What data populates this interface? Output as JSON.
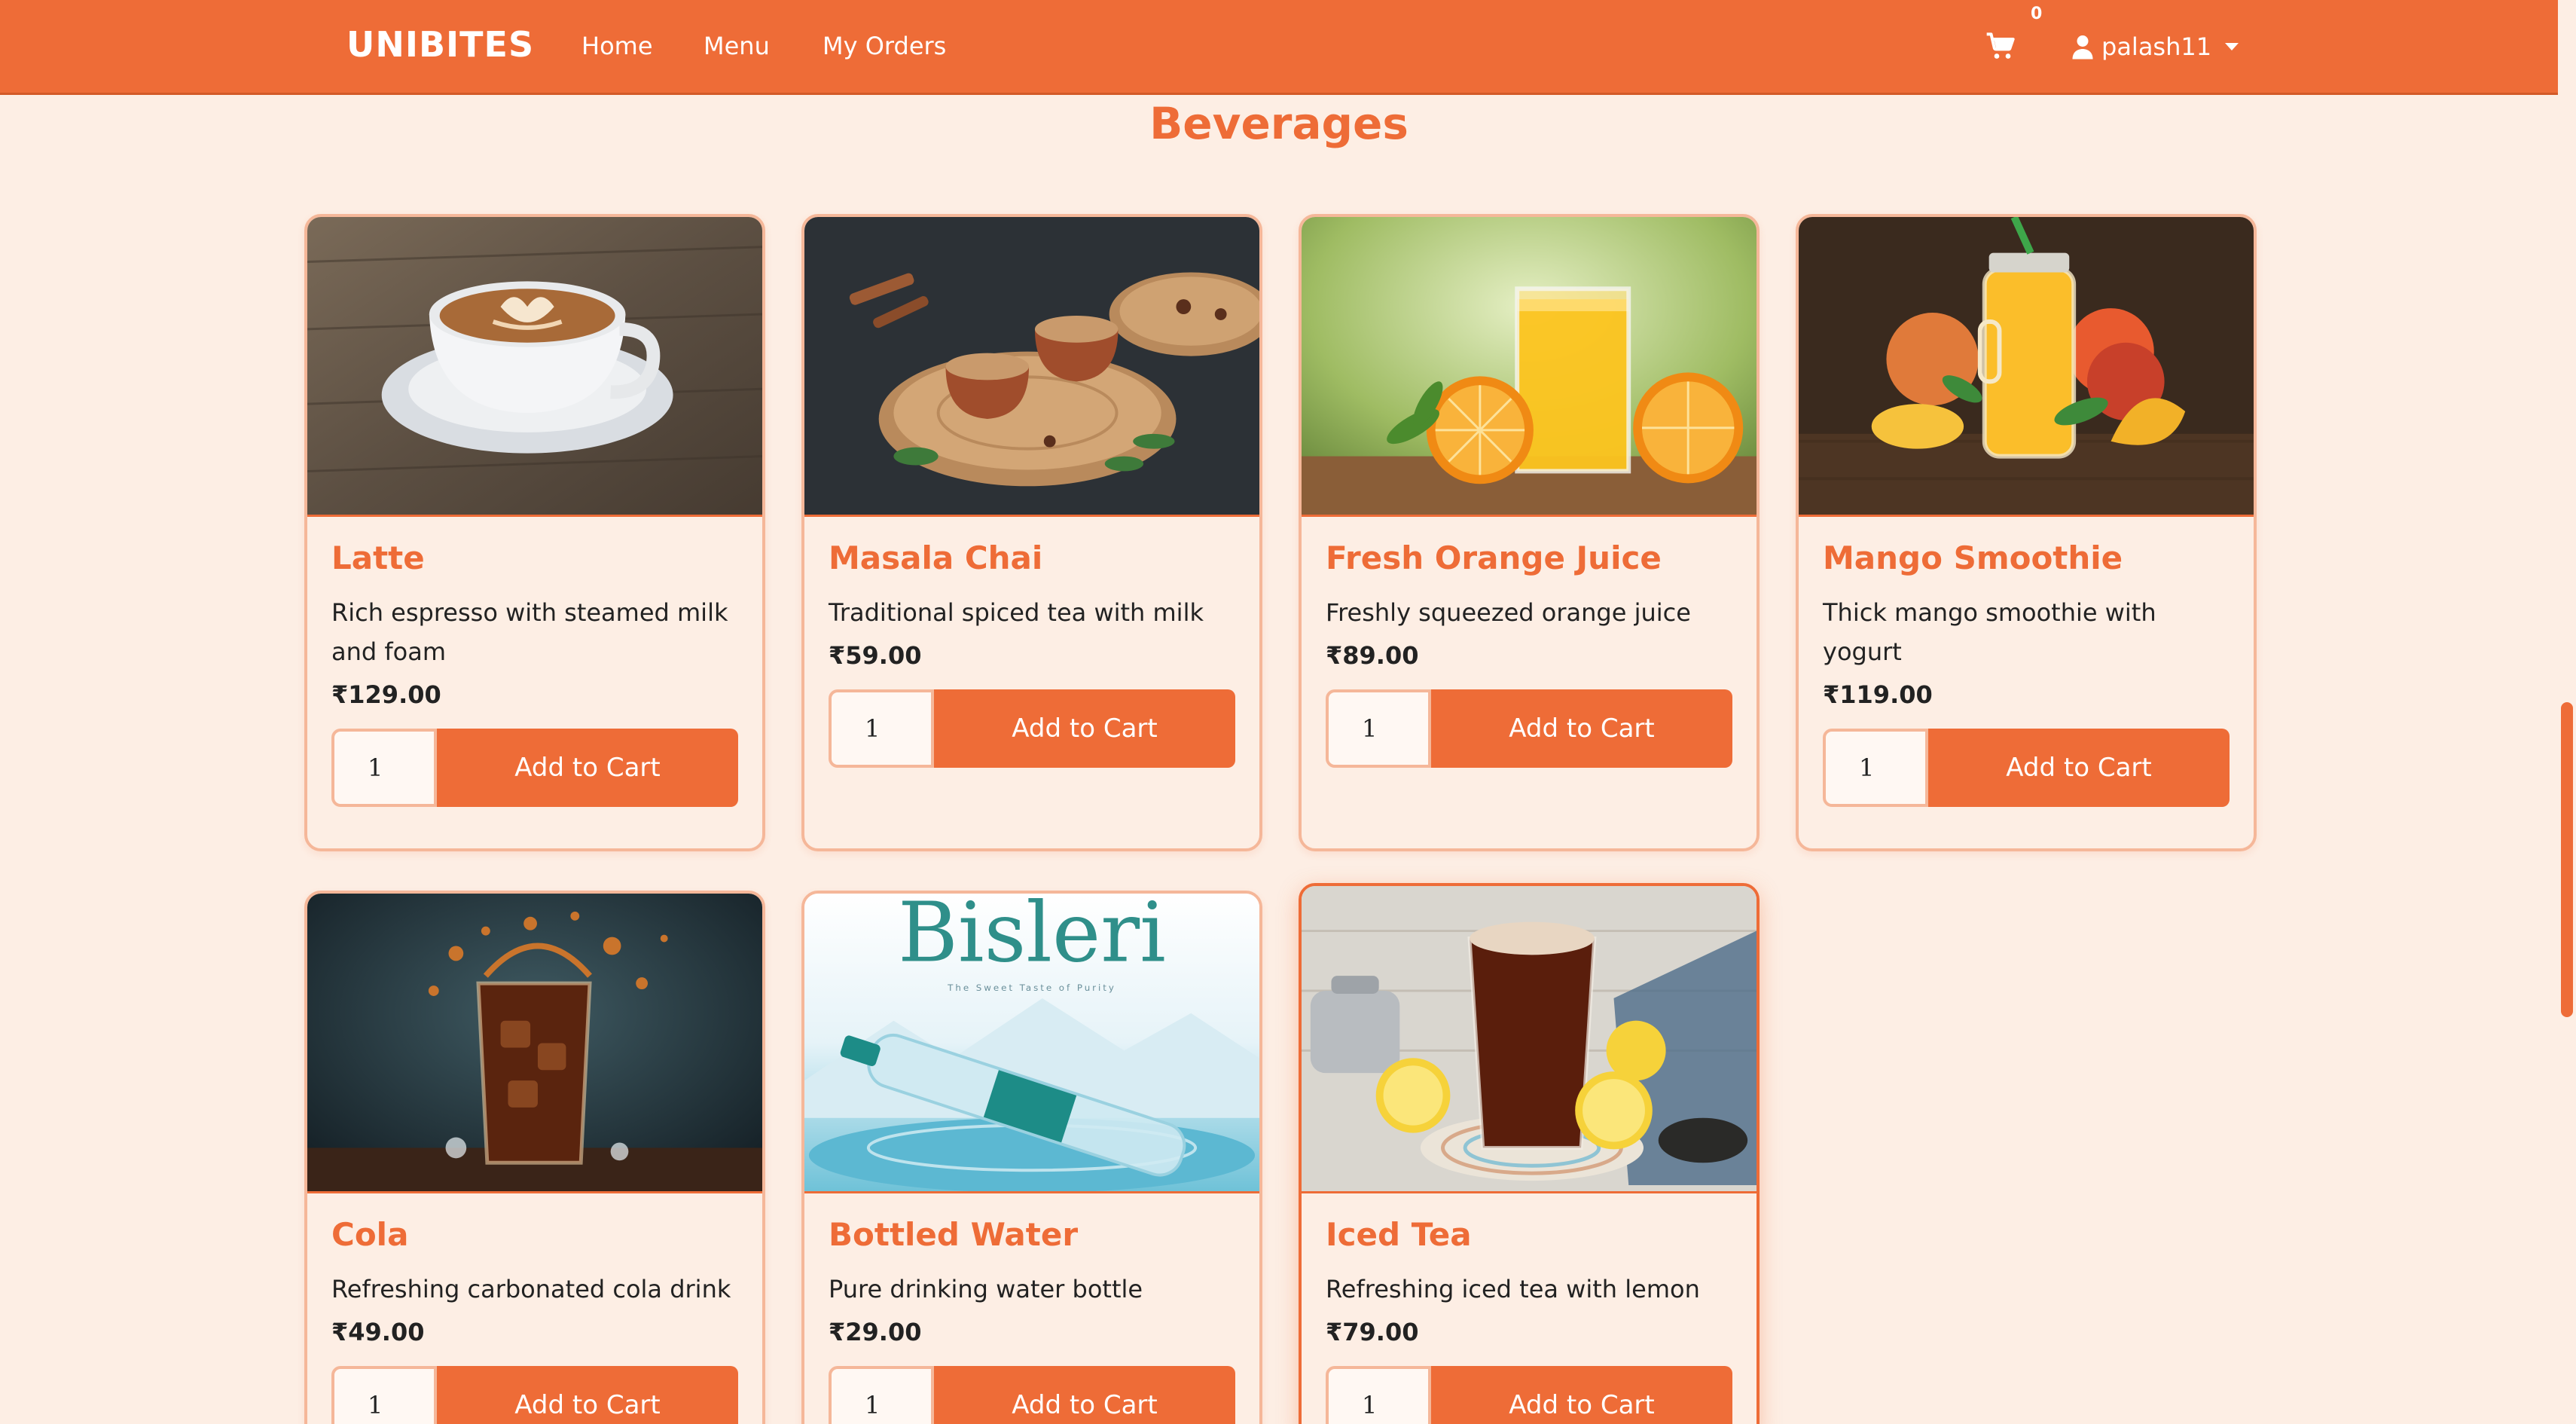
{
  "navbar": {
    "brand": "UNIBITES",
    "links": [
      "Home",
      "Menu",
      "My Orders"
    ],
    "cart_count": "0",
    "user": "palash11"
  },
  "section": {
    "title": "Beverages"
  },
  "products": [
    {
      "name": "Latte",
      "desc": "Rich espresso with steamed milk and foam",
      "price": "₹129.00",
      "qty": "1",
      "button": "Add to Cart"
    },
    {
      "name": "Masala Chai",
      "desc": "Traditional spiced tea with milk",
      "price": "₹59.00",
      "qty": "1",
      "button": "Add to Cart"
    },
    {
      "name": "Fresh Orange Juice",
      "desc": "Freshly squeezed orange juice",
      "price": "₹89.00",
      "qty": "1",
      "button": "Add to Cart"
    },
    {
      "name": "Mango Smoothie",
      "desc": "Thick mango smoothie with yogurt",
      "price": "₹119.00",
      "qty": "1",
      "button": "Add to Cart"
    },
    {
      "name": "Cola",
      "desc": "Refreshing carbonated cola drink",
      "price": "₹49.00",
      "qty": "1",
      "button": "Add to Cart"
    },
    {
      "name": "Bottled Water",
      "desc": "Pure drinking water bottle",
      "price": "₹29.00",
      "qty": "1",
      "button": "Add to Cart"
    },
    {
      "name": "Iced Tea",
      "desc": "Refreshing iced tea with lemon",
      "price": "₹79.00",
      "qty": "1",
      "button": "Add to Cart"
    }
  ],
  "images": {
    "bottled_water_logo": "Bisleri",
    "bottled_water_tagline": "The Sweet Taste of Purity"
  },
  "colors": {
    "accent": "#ee6c37",
    "background": "#fdeee4",
    "card_border": "#f5b799"
  },
  "icons": [
    "cart-icon",
    "user-icon",
    "chevron-down-icon"
  ]
}
